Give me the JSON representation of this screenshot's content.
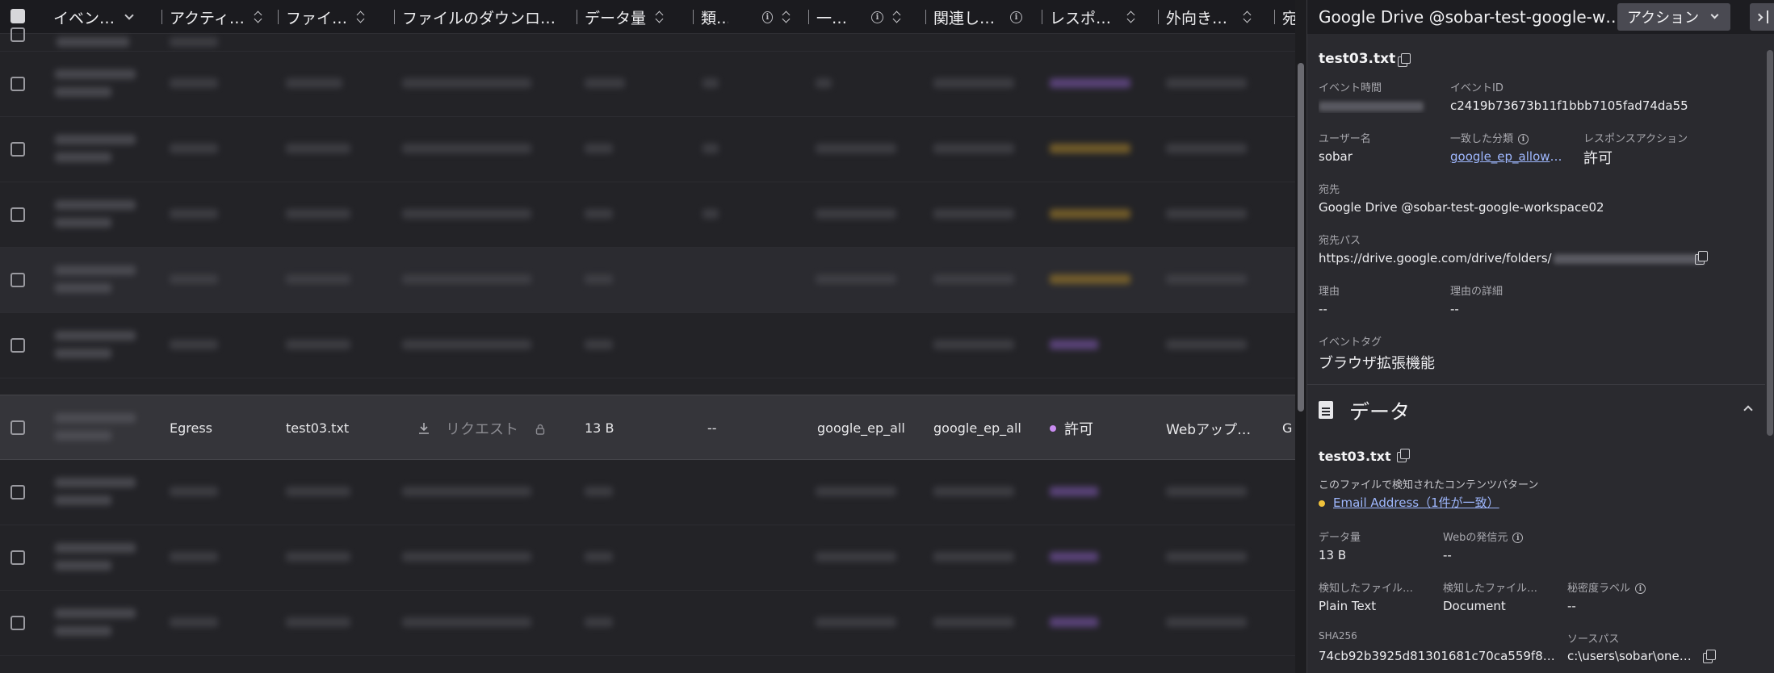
{
  "table": {
    "columns": [
      {
        "label": "イベン…",
        "icon": "chevron-down-icon"
      },
      {
        "label": "アクティ…",
        "icon": "sort-icon"
      },
      {
        "label": "ファイ…",
        "icon": "sort-icon"
      },
      {
        "label": "ファイルのダウンロ…",
        "icon": ""
      },
      {
        "label": "データ量",
        "icon": "sort-icon"
      },
      {
        "label": "類…",
        "icon": "info-sort"
      },
      {
        "label": "一…",
        "icon": "info-sort"
      },
      {
        "label": "関連し…",
        "icon": "info-icon"
      },
      {
        "label": "レスポ…",
        "icon": "sort-icon"
      },
      {
        "label": "外向き…",
        "icon": "sort-icon"
      },
      {
        "label": "宛",
        "icon": ""
      }
    ],
    "selected_row": {
      "activity": "Egress",
      "file": "test03.txt",
      "download_request": "リクエスト",
      "data_size": "13 B",
      "similar": "--",
      "match": "google_ep_all…",
      "related": "google_ep_all…",
      "response": "許可",
      "outbound": "Webアップ…",
      "dest": "G"
    }
  },
  "panel": {
    "title": "Google Drive @sobar-test-google-works…",
    "action_label": "アクション",
    "file_name": "test03.txt",
    "event_time_label": "イベント時間",
    "event_id_label": "イベントID",
    "event_id": "c2419b73673b11f1bbb7105fad74da55",
    "username_label": "ユーザー名",
    "username": "sobar",
    "matched_class_label": "一致した分類",
    "matched_class": "google_ep_allow_…",
    "response_action_label": "レスポンスアクション",
    "response_action": "許可",
    "destination_label": "宛先",
    "destination": "Google Drive @sobar-test-google-workspace02",
    "dest_path_label": "宛先パス",
    "dest_path": "https://drive.google.com/drive/folders/",
    "reason_label": "理由",
    "reason": "--",
    "reason_detail_label": "理由の詳細",
    "reason_detail": "--",
    "event_tag_label": "イベントタグ",
    "event_tag": "ブラウザ拡張機能",
    "data_section_title": "データ",
    "data_file_name": "test03.txt",
    "content_pattern_label": "このファイルで検知されたコンテンツパターン",
    "content_pattern": "Email Address（1件が一致）",
    "data_size_label": "データ量",
    "data_size": "13 B",
    "web_origin_label": "Webの発信元",
    "web_origin": "--",
    "detected_file1_label": "検知したファイル…",
    "detected_file1": "Plain Text",
    "detected_file2_label": "検知したファイル…",
    "detected_file2": "Document",
    "secret_label_label": "秘密度ラベル",
    "secret_label": "--",
    "sha_label": "SHA256",
    "sha": "74cb92b3925d81301681c70ca559f800…",
    "source_path_label": "ソースパス",
    "source_path": "c:\\users\\sobar\\oned…"
  }
}
